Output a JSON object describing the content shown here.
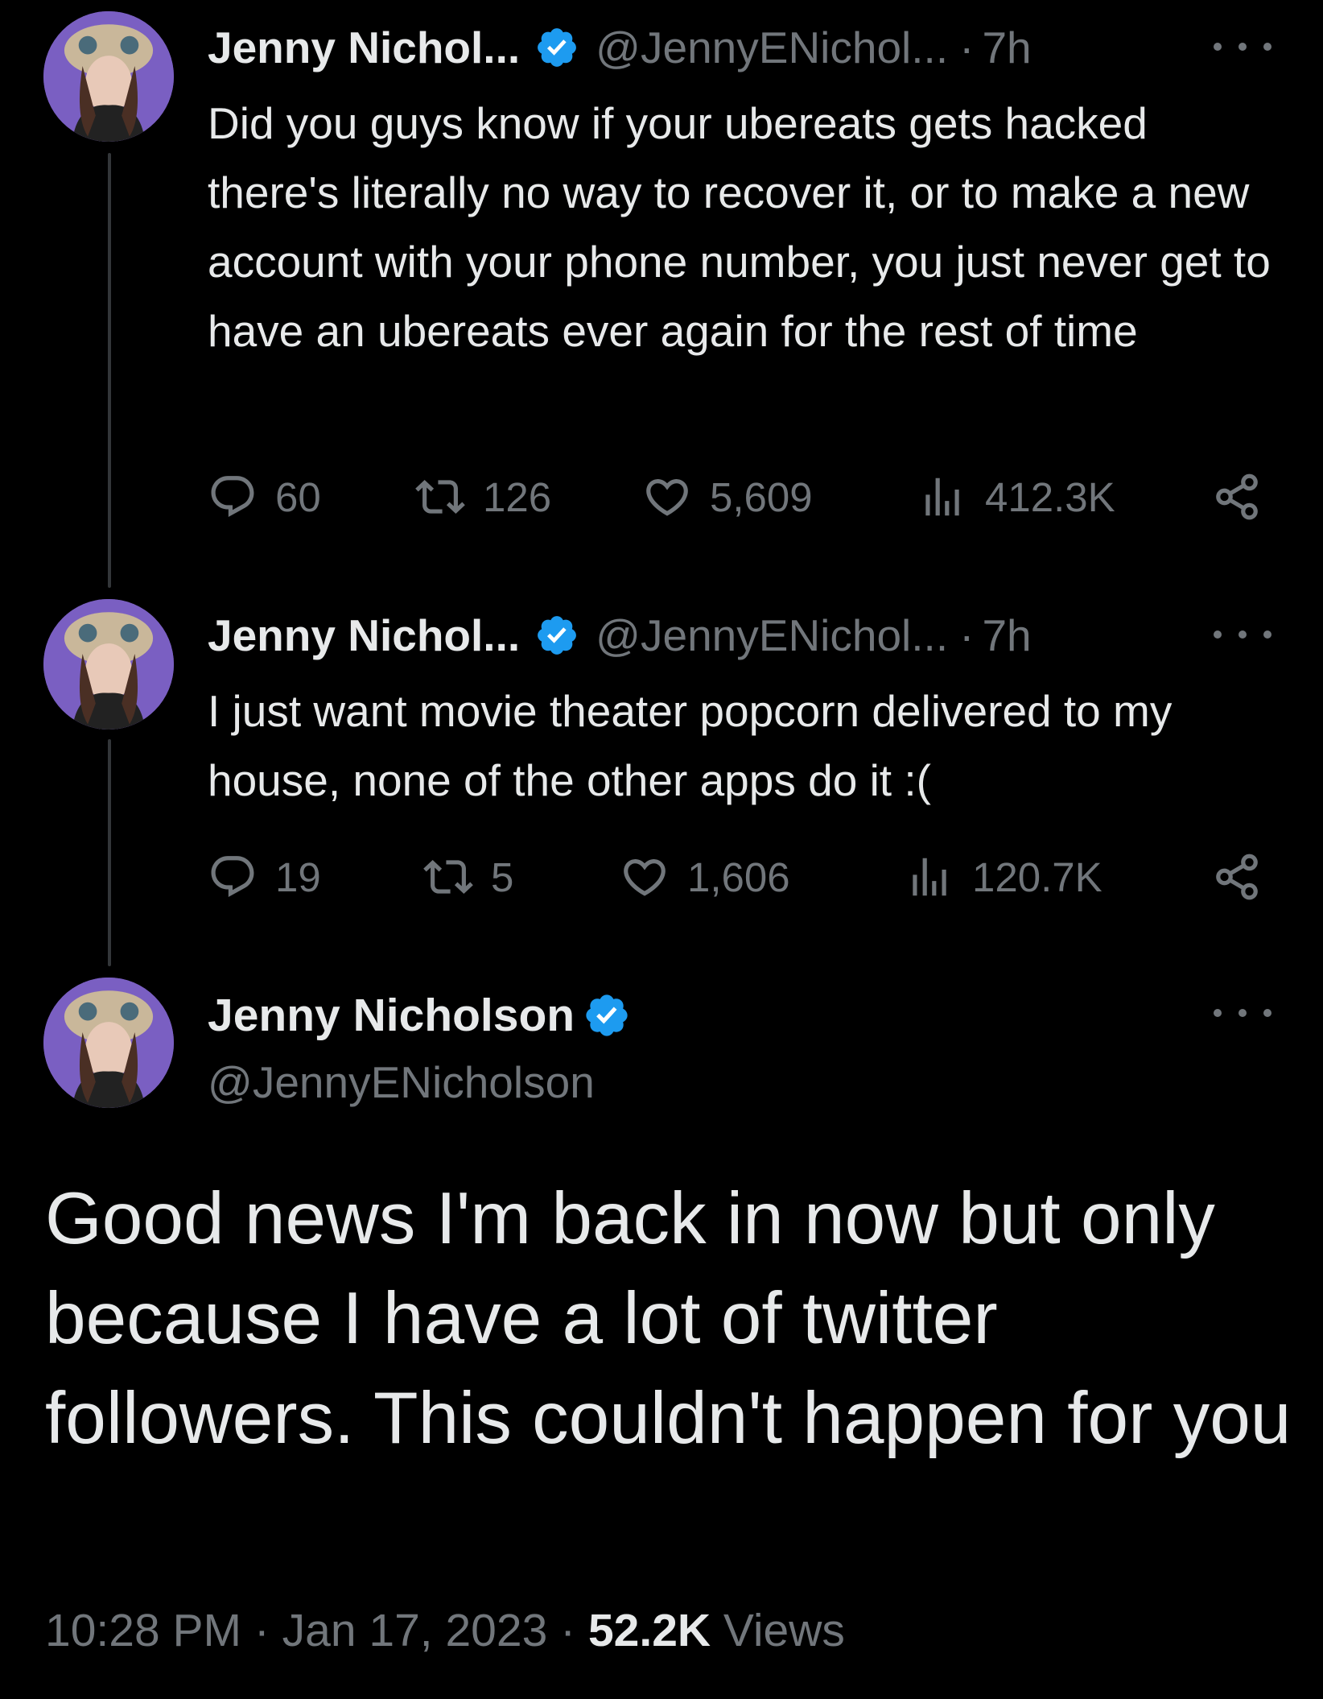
{
  "tweets": [
    {
      "name": "Jenny Nichol...",
      "handle": "@JennyENichol...",
      "separator": "·",
      "time": "7h",
      "text": "Did you guys know if your ubereats gets hacked there's literally no way to recover it, or to make a new account with your phone number, you just never get to have an ubereats ever again for the rest of time",
      "replies": "60",
      "retweets": "126",
      "likes": "5,609",
      "views": "412.3K"
    },
    {
      "name": "Jenny Nichol...",
      "handle": "@JennyENichol...",
      "separator": "·",
      "time": "7h",
      "text": "I just want movie theater popcorn delivered to my house, none of the other apps do it :(",
      "replies": "19",
      "retweets": "5",
      "likes": "1,606",
      "views": "120.7K"
    }
  ],
  "main_tweet": {
    "name": "Jenny Nicholson",
    "handle": "@JennyENicholson",
    "text": "Good news I'm back in now but only because I have a lot of twitter followers. This couldn't happen for you",
    "time": "10:28 PM",
    "sep1": "·",
    "date": "Jan 17, 2023",
    "sep2": "·",
    "views_count": "52.2K",
    "views_label": "Views"
  },
  "icons": {
    "verified": "verified-badge-icon",
    "more": "more-options-icon",
    "reply": "reply-icon",
    "retweet": "retweet-icon",
    "like": "heart-icon",
    "views": "views-chart-icon",
    "share": "share-icon"
  },
  "colors": {
    "background": "#000000",
    "text": "#e7e9ea",
    "muted": "#71767b",
    "verified": "#1d9bf0",
    "avatar_bg": "#7a5fc2"
  }
}
